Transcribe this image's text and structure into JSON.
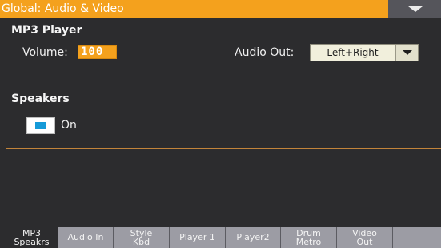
{
  "title": "Global: Audio & Video",
  "menu_icon": "chevron-down-icon",
  "mp3_player": {
    "section_title": "MP3 Player",
    "volume_label": "Volume:",
    "volume_value": "100",
    "audio_out_label": "Audio Out:",
    "audio_out_value": "Left+Right"
  },
  "speakers": {
    "section_title": "Speakers",
    "on_label": "On",
    "on_checked": true
  },
  "tabs": [
    {
      "line1": "MP3",
      "line2": "Speakrs",
      "active": true
    },
    {
      "line1": "Audio In",
      "line2": "",
      "active": false
    },
    {
      "line1": "Style",
      "line2": "Kbd",
      "active": false
    },
    {
      "line1": "Player 1",
      "line2": "",
      "active": false
    },
    {
      "line1": "Player2",
      "line2": "",
      "active": false
    },
    {
      "line1": "Drum",
      "line2": "Metro",
      "active": false
    },
    {
      "line1": "Video",
      "line2": "Out",
      "active": false
    }
  ],
  "colors": {
    "accent": "#f4a11d",
    "background": "#2c2c2e",
    "separator": "#c2843a",
    "tab_inactive": "#9c9ca4",
    "checkbox_fill": "#159ad8"
  }
}
